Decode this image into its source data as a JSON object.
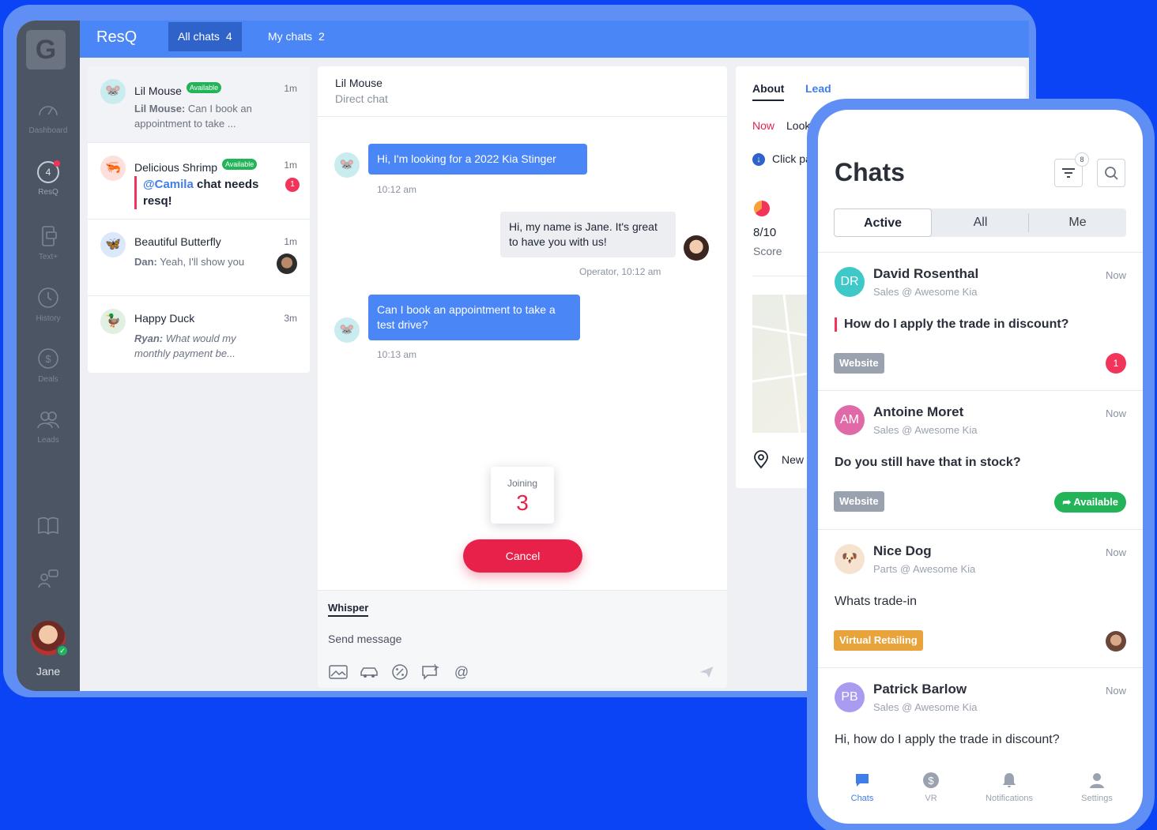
{
  "desktop": {
    "logo_letter": "G",
    "brand": "ResQ",
    "top_tabs": [
      {
        "label": "All chats",
        "count": "4"
      },
      {
        "label": "My chats",
        "count": "2"
      }
    ],
    "rail": {
      "items": [
        {
          "label": "Dashboard",
          "icon": "gauge-icon"
        },
        {
          "label": "ResQ",
          "icon": "resq-icon",
          "count": "4"
        },
        {
          "label": "Text+",
          "icon": "phone-text-icon"
        },
        {
          "label": "History",
          "icon": "clock-icon"
        },
        {
          "label": "Deals",
          "icon": "dollar-icon"
        },
        {
          "label": "Leads",
          "icon": "people-icon"
        }
      ],
      "extra_icons": [
        "book-icon",
        "support-icon"
      ],
      "user_name": "Jane"
    },
    "chat_list": [
      {
        "name": "Lil Mouse",
        "badge": "Available",
        "time": "1m",
        "sender": "Lil Mouse:",
        "preview": "Can I book an appointment to take ..."
      },
      {
        "name": "Delicious Shrimp",
        "badge": "Available",
        "time": "1m",
        "mention": "@Camila",
        "preview": "chat needs resq!",
        "unread": "1"
      },
      {
        "name": "Beautiful Butterfly",
        "time": "1m",
        "sender": "Dan:",
        "preview": "Yeah, I'll show you"
      },
      {
        "name": "Happy Duck",
        "time": "3m",
        "sender": "Ryan:",
        "preview": "What would my monthly payment be..."
      }
    ],
    "conversation": {
      "title": "Lil Mouse",
      "subtitle": "Direct chat",
      "messages": [
        {
          "text": "Hi, I'm looking for a 2022 Kia Stinger",
          "time": "10:12 am"
        },
        {
          "text": "Hi, my name is Jane. It's great to have you with us!",
          "time": "Operator, 10:12 am"
        },
        {
          "text": "Can I book an appointment to take a test drive?",
          "time": "10:13 am"
        }
      ],
      "joining_label": "Joining",
      "joining_count": "3",
      "cancel_label": "Cancel",
      "composer_tab": "Whisper",
      "composer_placeholder": "Send message"
    },
    "details": {
      "tabs": [
        "About",
        "Lead"
      ],
      "now_label": "Now",
      "now_text": "Looki",
      "click_text": "Click pa",
      "score": "8/10",
      "score_label": "Score",
      "location": "New Y"
    }
  },
  "mobile": {
    "title": "Chats",
    "filter_count": "8",
    "segments": [
      "Active",
      "All",
      "Me"
    ],
    "cards": [
      {
        "initials": "DR",
        "name": "David Rosenthal",
        "sub": "Sales @ Awesome Kia",
        "time": "Now",
        "message": "How do I apply the trade in discount?",
        "tag": "Website",
        "unread": "1",
        "color": "#3ec8c8"
      },
      {
        "initials": "AM",
        "name": "Antoine Moret",
        "sub": "Sales @ Awesome Kia",
        "time": "Now",
        "message": "Do you still have that in stock?",
        "tag": "Website",
        "status": "Available",
        "color": "#e06aa8"
      },
      {
        "initials": "",
        "name": "Nice Dog",
        "sub": "Parts @ Awesome Kia",
        "time": "Now",
        "message": "Whats trade-in",
        "tag": "Virtual Retailing",
        "color": "#f6e3cf"
      },
      {
        "initials": "PB",
        "name": "Patrick Barlow",
        "sub": "Sales @ Awesome Kia",
        "time": "Now",
        "message": "Hi, how do I apply the trade in discount?",
        "color": "#a99cf0"
      }
    ],
    "nav": [
      "Chats",
      "VR",
      "Notifications",
      "Settings"
    ]
  },
  "colors": {
    "page_bg": "#0a44f5",
    "frame": "#5f8ff5",
    "primary": "#4a86f5",
    "alert": "#e8214a",
    "success": "#23b45a",
    "tag_website": "#9aa2b0",
    "tag_vr": "#e8a33a"
  }
}
